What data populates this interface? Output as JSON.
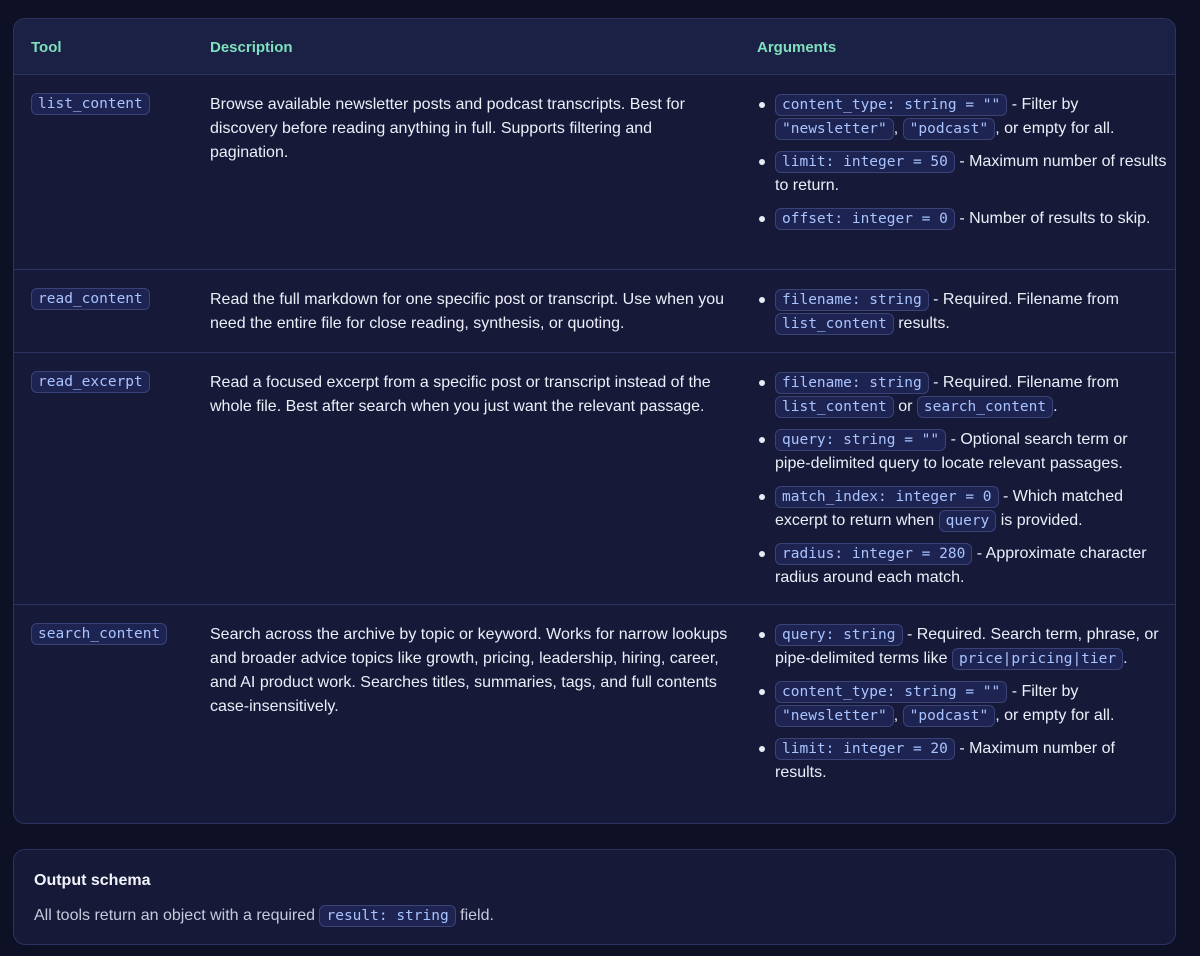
{
  "table": {
    "headers": {
      "tool": "Tool",
      "description": "Description",
      "arguments": "Arguments"
    },
    "rows": [
      {
        "tool": "list_content",
        "description": "Browse available newsletter posts and podcast transcripts. Best for discovery before reading anything in full. Supports filtering and pagination.",
        "args": [
          [
            {
              "code": "content_type: string = \"\""
            },
            {
              "text": " - Filter by "
            },
            {
              "code": "\"newsletter\""
            },
            {
              "text": ", "
            },
            {
              "code": "\"podcast\""
            },
            {
              "text": ", or empty for all."
            }
          ],
          [
            {
              "code": "limit: integer = 50"
            },
            {
              "text": " - Maximum number of results to return."
            }
          ],
          [
            {
              "code": "offset: integer = 0"
            },
            {
              "text": " - Number of results to skip."
            }
          ]
        ]
      },
      {
        "tool": "read_content",
        "description": "Read the full markdown for one specific post or transcript. Use when you need the entire file for close reading, synthesis, or quoting.",
        "args": [
          [
            {
              "code": "filename: string"
            },
            {
              "text": " - Required. Filename from "
            },
            {
              "code": "list_content"
            },
            {
              "text": " results."
            }
          ]
        ]
      },
      {
        "tool": "read_excerpt",
        "description": "Read a focused excerpt from a specific post or transcript instead of the whole file. Best after search when you just want the relevant passage.",
        "args": [
          [
            {
              "code": "filename: string"
            },
            {
              "text": " - Required. Filename from "
            },
            {
              "code": "list_content"
            },
            {
              "text": " or "
            },
            {
              "code": "search_content"
            },
            {
              "text": "."
            }
          ],
          [
            {
              "code": "query: string = \"\""
            },
            {
              "text": " - Optional search term or pipe-delimited query to locate relevant passages."
            }
          ],
          [
            {
              "code": "match_index: integer = 0"
            },
            {
              "text": " - Which matched excerpt to return when "
            },
            {
              "code": "query"
            },
            {
              "text": " is provided."
            }
          ],
          [
            {
              "code": "radius: integer = 280"
            },
            {
              "text": " - Approximate character radius around each match."
            }
          ]
        ]
      },
      {
        "tool": "search_content",
        "description": "Search across the archive by topic or keyword. Works for narrow lookups and broader advice topics like growth, pricing, leadership, hiring, career, and AI product work. Searches titles, summaries, tags, and full contents case-insensitively.",
        "args": [
          [
            {
              "code": "query: string"
            },
            {
              "text": " - Required. Search term, phrase, or pipe-delimited terms like "
            },
            {
              "code": "price|pricing|tier"
            },
            {
              "text": "."
            }
          ],
          [
            {
              "code": "content_type: string = \"\""
            },
            {
              "text": " - Filter by "
            },
            {
              "code": "\"newsletter\""
            },
            {
              "text": ", "
            },
            {
              "code": "\"podcast\""
            },
            {
              "text": ", or empty for all."
            }
          ],
          [
            {
              "code": "limit: integer = 20"
            },
            {
              "text": " - Maximum number of results."
            }
          ]
        ]
      }
    ]
  },
  "output_schema": {
    "title": "Output schema",
    "text_before": "All tools return an object with a required ",
    "code": "result: string",
    "text_after": " field."
  }
}
